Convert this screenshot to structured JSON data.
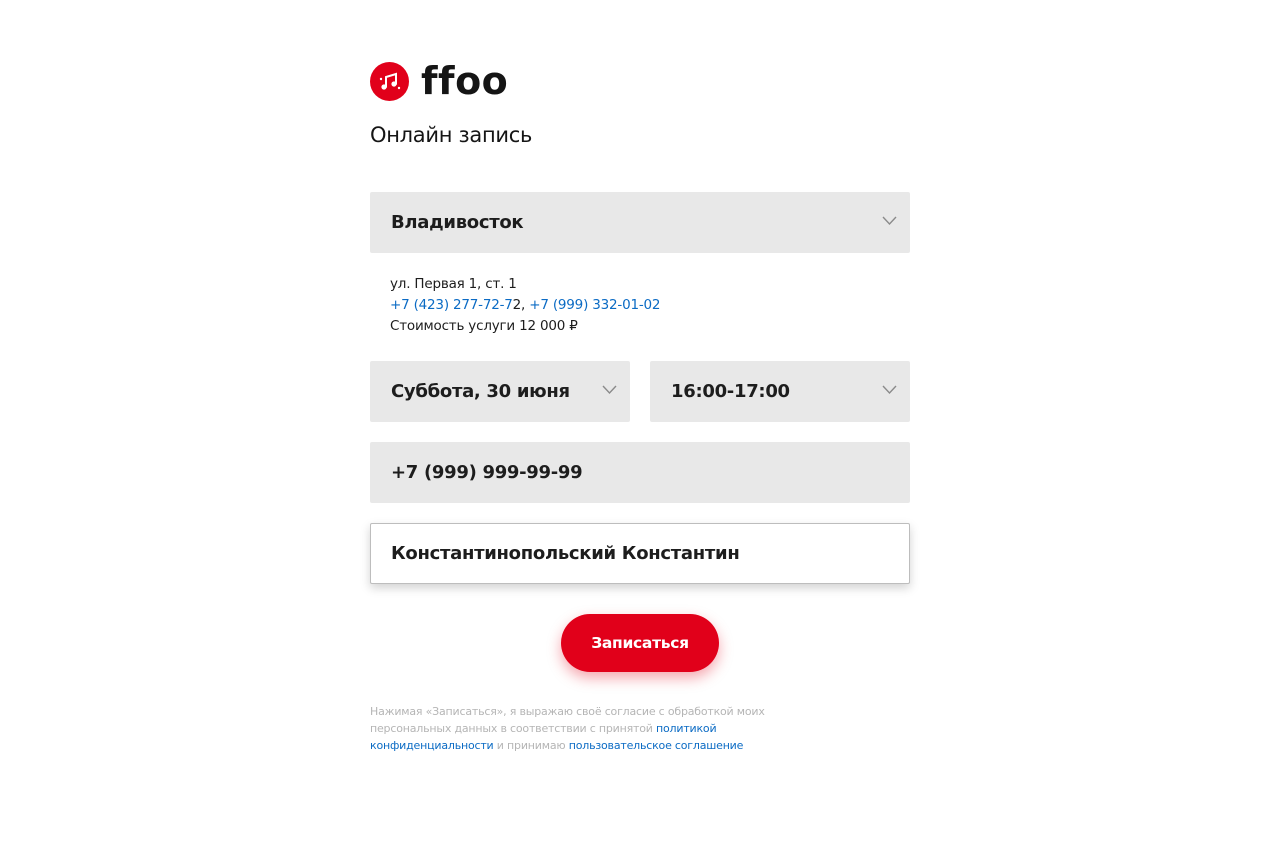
{
  "brand": {
    "name": "ffoo",
    "color": "#e1001a",
    "icon": "music-notes-icon"
  },
  "page": {
    "title": "Онлайн запись"
  },
  "city_select": {
    "value": "Владивосток"
  },
  "location": {
    "address": "ул. Первая 1, ст. 1",
    "phone_1": "+7 (423) 277-72-7",
    "phone_1_tail": "2, ",
    "phone_2": "+7 (999) 332-01-02",
    "price": "Стоимость услуги 12 000 ₽"
  },
  "date_select": {
    "value": "Суббота, 30 июня"
  },
  "time_select": {
    "value": "16:00-17:00"
  },
  "phone_input": {
    "value": "+7 (999) 999-99-99"
  },
  "name_input": {
    "value": "Константинопольский Константин"
  },
  "submit": {
    "label": "Записаться"
  },
  "consent": {
    "text_1": "Нажимая «Записаться», я выражаю своё согласие с обработкой моих персональных данных в соответствии с принятой ",
    "privacy_link": "политикой конфиденциальности",
    "text_2": " и принимаю ",
    "agreement_link": "пользовательское соглашение"
  },
  "colors": {
    "accent": "#e1001a",
    "link": "#0b6bc4",
    "field_bg": "#e8e8e8"
  }
}
